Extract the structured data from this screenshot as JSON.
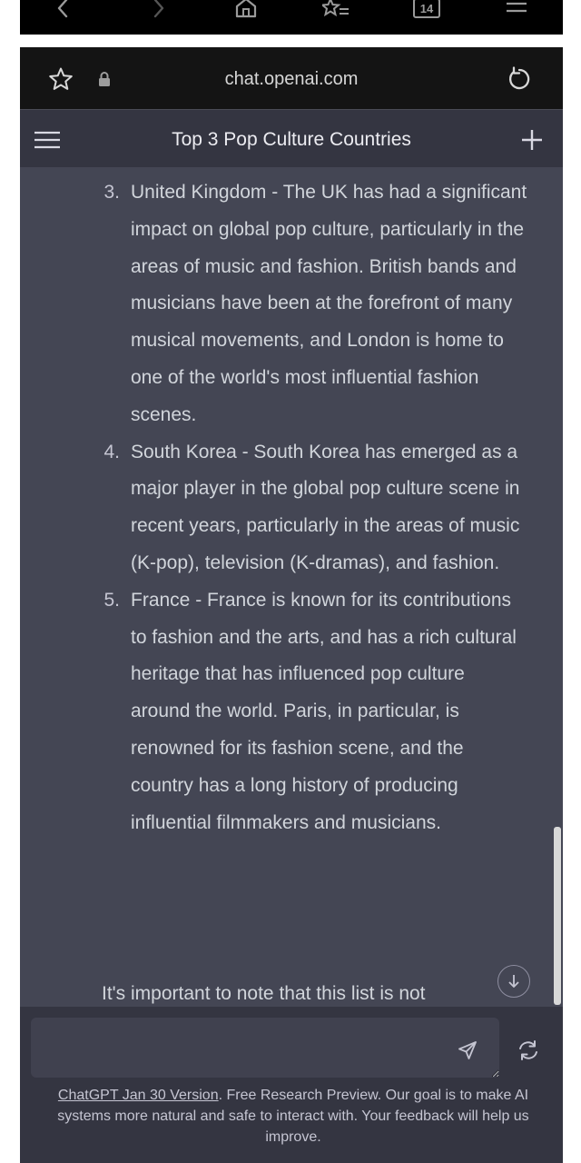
{
  "browser": {
    "tab_count": "14",
    "url": "chat.openai.com"
  },
  "header": {
    "title": "Top 3 Pop Culture Countries"
  },
  "conversation": {
    "items": [
      {
        "number": "3.",
        "text": "United Kingdom - The UK has had a significant impact on global pop culture, particularly in the areas of music and fashion. British bands and musicians have been at the forefront of many musical movements, and London is home to one of the world's most influential fashion scenes."
      },
      {
        "number": "4.",
        "text": "South Korea - South Korea has emerged as a major player in the global pop culture scene in recent years, particularly in the areas of music (K-pop), television (K-dramas), and fashion."
      },
      {
        "number": "5.",
        "text": "France - France is known for its contributions to fashion and the arts, and has a rich cultural heritage that has influenced pop culture around the world. Paris, in particular, is renowned for its fashion scene, and the country has a long history of producing influential filmmakers and musicians."
      }
    ],
    "note": "It's important to note that this list is not"
  },
  "footer": {
    "version_link": "ChatGPT Jan 30 Version",
    "text": ". Free Research Preview. Our goal is to make AI systems more natural and safe to interact with. Your feedback will help us improve."
  },
  "icons": {
    "back": "chevron-left-icon",
    "forward": "chevron-right-icon",
    "home": "home-icon",
    "bookmarks": "bookmarks-icon",
    "tabs": "tabs-icon",
    "menu": "menu-icon",
    "star": "star-icon",
    "lock": "lock-icon",
    "reload": "reload-icon",
    "hamburger": "hamburger-icon",
    "new_chat": "plus-icon",
    "scroll_down": "arrow-down-icon",
    "send": "send-icon",
    "regenerate": "regenerate-icon"
  },
  "colors": {
    "header_bg": "#343541",
    "message_bg": "#444654",
    "text": "#d1d5db",
    "browser_bar": "#141414"
  }
}
